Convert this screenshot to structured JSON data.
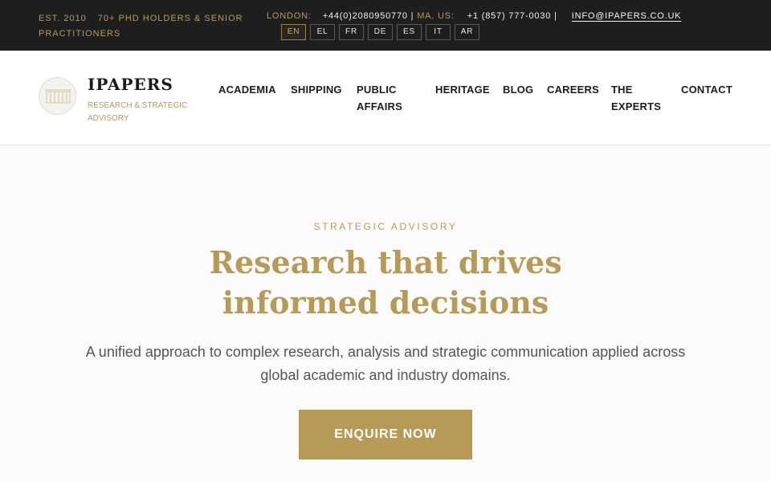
{
  "topbar": {
    "est": "EST. 2010",
    "phd": "70+ PHD HOLDERS & SENIOR PRACTITIONERS",
    "london_label": "LONDON:",
    "london_phone": "+44(0)2080950770",
    "us_label": "MA, US:",
    "us_phone": "+1 (857) 777-0030",
    "separator": "|",
    "email": "INFO@IPAPERS.CO.UK",
    "languages": [
      "EN",
      "EL",
      "FR",
      "DE",
      "ES",
      "IT",
      "AR"
    ],
    "active_language": "EN"
  },
  "header": {
    "logo_name": "IPAPERS",
    "logo_tagline": "RESEARCH & STRATEGIC ADVISORY",
    "nav": [
      "ACADEMIA",
      "SHIPPING",
      "PUBLIC AFFAIRS",
      "HERITAGE",
      "BLOG",
      "CAREERS",
      "THE EXPERTS",
      "CONTACT"
    ]
  },
  "hero": {
    "eyebrow": "STRATEGIC ADVISORY",
    "headline": "Research that drives informed decisions",
    "subtext": "A unified approach to complex research, analysis and strategic communication applied across global academic and industry domains.",
    "cta": "ENQUIRE NOW"
  },
  "colors": {
    "accent": "#b89a57",
    "topbar_bg": "#1e1e1e",
    "hero_bg": "#fbfbfb"
  }
}
